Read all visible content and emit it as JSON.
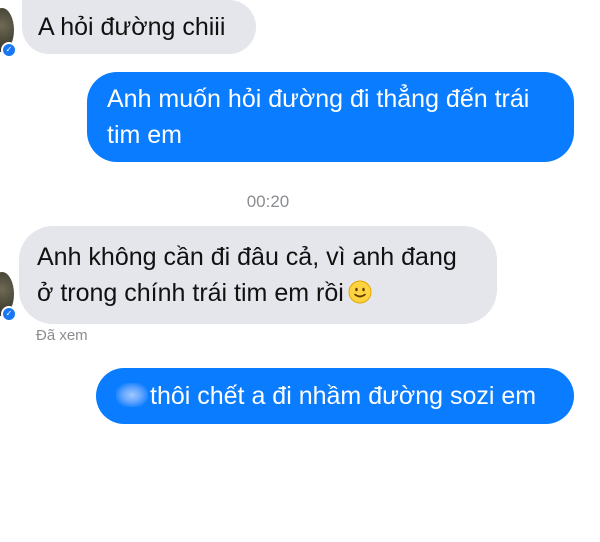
{
  "messages": [
    {
      "id": "m1",
      "direction": "incoming",
      "text": "A hỏi đường chiii"
    },
    {
      "id": "m2",
      "direction": "outgoing",
      "text": "Anh muốn hỏi đường đi thẳng đến trái tim em"
    },
    {
      "id": "m3",
      "direction": "incoming",
      "line1": "Anh không cần đi đâu cả, vì anh đang",
      "line2": "ở trong chính trái tim em rồi",
      "emoji": "slightly-smiling-face-icon"
    },
    {
      "id": "m4",
      "direction": "outgoing",
      "text": "thôi chết a đi nhầm đường sozi em",
      "redacted_prefix": true
    }
  ],
  "timestamp": "00:20",
  "seen_label": "Đã xem",
  "colors": {
    "outgoing_bubble": "#0a7cff",
    "incoming_bubble": "#e4e6eb",
    "meta_text": "#8a8d91",
    "verified_badge": "#1877f2"
  }
}
